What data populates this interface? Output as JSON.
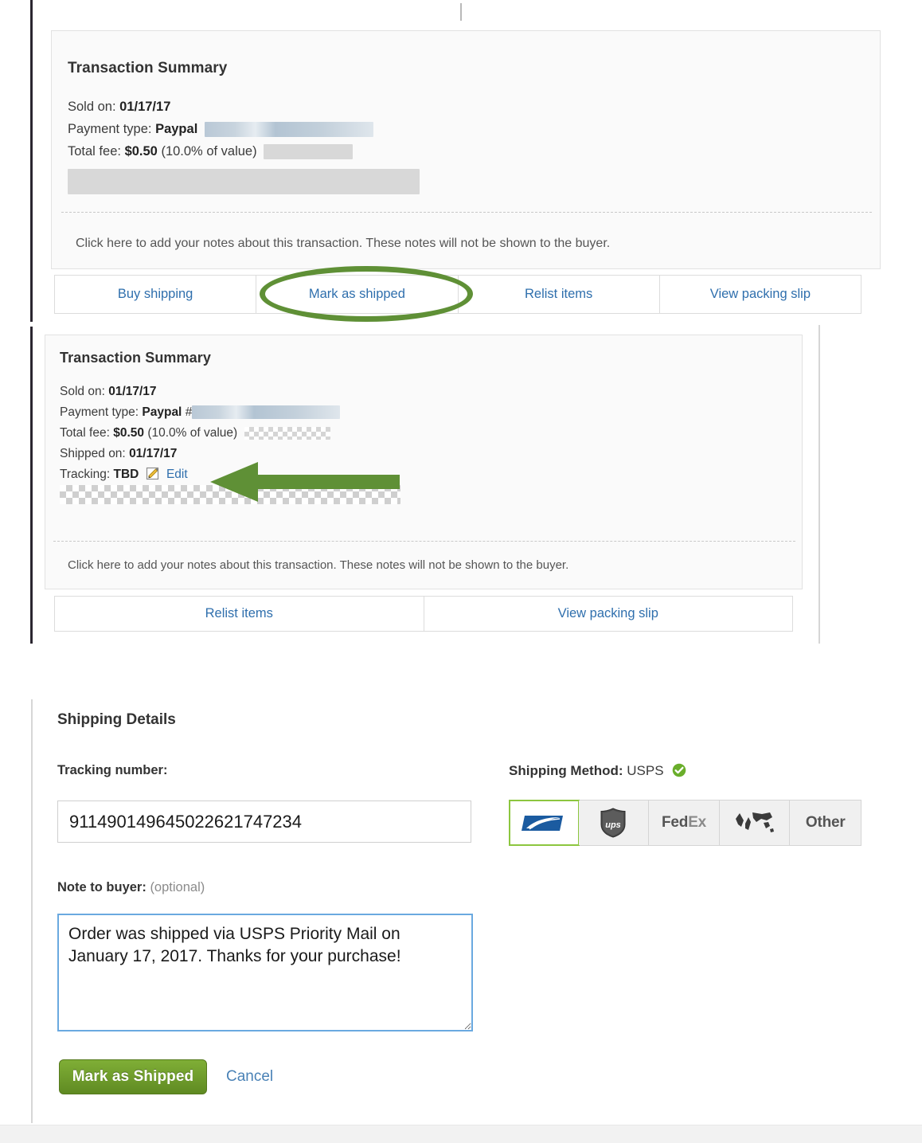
{
  "panel_one": {
    "title": "Transaction Summary",
    "rows": [
      {
        "label": "Sold on:",
        "value": "01/17/17"
      },
      {
        "label": "Payment type:",
        "value": "Paypal"
      },
      {
        "label": "Total fee:",
        "value": "$0.50",
        "suffix": "(10.0% of value)"
      }
    ],
    "notes_prompt": "Click here to add your notes about this transaction. These notes will not be shown to the buyer.",
    "actions": [
      "Buy shipping",
      "Mark as shipped",
      "Relist items",
      "View packing slip"
    ]
  },
  "panel_two": {
    "title": "Transaction Summary",
    "rows": [
      {
        "label": "Sold on:",
        "value": "01/17/17"
      },
      {
        "label": "Payment type:",
        "value": "Paypal",
        "suffix": "#"
      },
      {
        "label": "Total fee:",
        "value": "$0.50",
        "suffix": "(10.0% of value)"
      },
      {
        "label": "Shipped on:",
        "value": "01/17/17"
      },
      {
        "label": "Tracking:",
        "value": "TBD",
        "edit_link": "Edit"
      }
    ],
    "notes_prompt": "Click here to add your notes about this transaction. These notes will not be shown to the buyer.",
    "actions": [
      "Relist items",
      "View packing slip"
    ]
  },
  "shipping_details": {
    "heading": "Shipping Details",
    "tracking_label": "Tracking number:",
    "tracking_value": "911490149645022621747234",
    "note_label": "Note to buyer:",
    "note_optional": "(optional)",
    "note_value": "Order was shipped via USPS Priority Mail on January 17, 2017. Thanks for your purchase! ",
    "method_label": "Shipping Method:",
    "method_value": "USPS",
    "carriers": [
      {
        "id": "usps-icon",
        "label": "USPS",
        "selected": true
      },
      {
        "id": "ups-icon",
        "label": "UPS",
        "selected": false
      },
      {
        "id": "fedex-icon",
        "label": "FedEx",
        "selected": false
      },
      {
        "id": "globe-icon",
        "label": "International",
        "selected": false
      },
      {
        "id": "other-option",
        "label": "Other",
        "selected": false
      }
    ],
    "submit_label": "Mark as Shipped",
    "cancel_label": "Cancel"
  },
  "annotations": {
    "ellipse_target": "Mark as shipped",
    "arrow_target": "Edit",
    "accent_green": "#5f9036"
  }
}
